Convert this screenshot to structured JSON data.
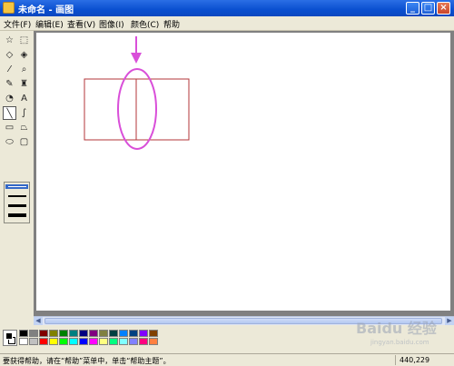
{
  "window": {
    "title": "未命名 - 画图",
    "buttons": {
      "minimize": "_",
      "maximize": "□",
      "close": "×"
    }
  },
  "menu": {
    "items": [
      {
        "label": "文件(F)"
      },
      {
        "label": "编辑(E)"
      },
      {
        "label": "查看(V)"
      },
      {
        "label": "图像(I)"
      },
      {
        "label": "颜色(C)"
      },
      {
        "label": "帮助"
      }
    ]
  },
  "tools": [
    {
      "name": "free-select-icon",
      "glyph": "☆"
    },
    {
      "name": "rect-select-icon",
      "glyph": "⬚"
    },
    {
      "name": "eraser-icon",
      "glyph": "◇"
    },
    {
      "name": "fill-bucket-icon",
      "glyph": "◈"
    },
    {
      "name": "eyedropper-icon",
      "glyph": "⁄"
    },
    {
      "name": "magnifier-icon",
      "glyph": "⌕"
    },
    {
      "name": "pencil-icon",
      "glyph": "✎"
    },
    {
      "name": "brush-icon",
      "glyph": "♜"
    },
    {
      "name": "airbrush-icon",
      "glyph": "◔"
    },
    {
      "name": "text-icon",
      "glyph": "A"
    },
    {
      "name": "line-icon",
      "glyph": "╲"
    },
    {
      "name": "curve-icon",
      "glyph": "∫"
    },
    {
      "name": "rectangle-icon",
      "glyph": "▭"
    },
    {
      "name": "polygon-icon",
      "glyph": "⏢"
    },
    {
      "name": "ellipse-icon",
      "glyph": "⬭"
    },
    {
      "name": "rounded-rect-icon",
      "glyph": "▢"
    }
  ],
  "selected_tool": "line-icon",
  "canvas": {
    "annotation_color": "#d94fd9",
    "rect_color": "#b3363a"
  },
  "palette": {
    "foreground": "#000000",
    "background": "#ffffff",
    "colors_top": [
      "#000000",
      "#808080",
      "#800000",
      "#808000",
      "#008000",
      "#008080",
      "#000080",
      "#800080",
      "#808040",
      "#004040",
      "#0080ff",
      "#004080",
      "#8000ff",
      "#804000"
    ],
    "colors_bottom": [
      "#ffffff",
      "#c0c0c0",
      "#ff0000",
      "#ffff00",
      "#00ff00",
      "#00ffff",
      "#0000ff",
      "#ff00ff",
      "#ffff80",
      "#00ff80",
      "#80ffff",
      "#8080ff",
      "#ff0080",
      "#ff8040"
    ]
  },
  "status": {
    "help_text": "要获得帮助，请在“帮助”菜单中，单击“帮助主题”。",
    "coords": "440,229"
  },
  "watermark": {
    "text": "Baidu 经验",
    "sub": "jingyan.baidu.com"
  }
}
